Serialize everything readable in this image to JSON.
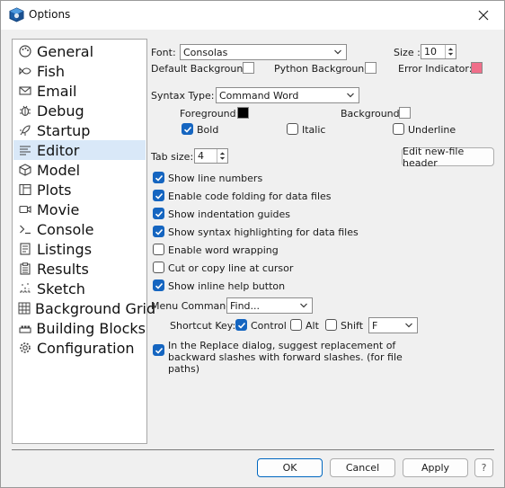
{
  "window": {
    "title": "Options"
  },
  "sidebar": {
    "items": [
      {
        "label": "General",
        "icon": "palette-icon"
      },
      {
        "label": "Fish",
        "icon": "fish-icon"
      },
      {
        "label": "Email",
        "icon": "envelope-icon"
      },
      {
        "label": "Debug",
        "icon": "bug-icon"
      },
      {
        "label": "Startup",
        "icon": "rocket-icon"
      },
      {
        "label": "Editor",
        "icon": "text-lines-icon",
        "selected": true
      },
      {
        "label": "Model",
        "icon": "cube-icon"
      },
      {
        "label": "Plots",
        "icon": "plot-window-icon"
      },
      {
        "label": "Movie",
        "icon": "camera-icon"
      },
      {
        "label": "Console",
        "icon": "terminal-prompt-icon"
      },
      {
        "label": "Listings",
        "icon": "list-icon"
      },
      {
        "label": "Results",
        "icon": "clipboard-icon"
      },
      {
        "label": "Sketch",
        "icon": "sketch-icon"
      },
      {
        "label": "Background Grid",
        "icon": "grid-icon"
      },
      {
        "label": "Building Blocks",
        "icon": "blocks-icon"
      },
      {
        "label": "Configuration",
        "icon": "gear-icon"
      }
    ]
  },
  "editor": {
    "font_label": "Font:",
    "font_value": "Consolas",
    "size_label": "Size :",
    "size_value": "10",
    "default_bg_label": "Default Background:",
    "python_bg_label": "Python Background:",
    "error_indicator_label": "Error Indicator:",
    "error_indicator_color": "#f06f8a",
    "syntax_type_label": "Syntax Type:",
    "syntax_type_value": "Command Word",
    "foreground_label": "Foreground:",
    "foreground_color": "#000000",
    "background_label": "Background:",
    "bold_label": "Bold",
    "italic_label": "Italic",
    "underline_label": "Underline",
    "tab_size_label": "Tab size:",
    "tab_size_value": "4",
    "edit_header_button": "Edit new-file header",
    "options": [
      {
        "label": "Show line numbers",
        "checked": true
      },
      {
        "label": "Enable code folding for data files",
        "checked": true
      },
      {
        "label": "Show indentation guides",
        "checked": true
      },
      {
        "label": "Show syntax highlighting for data files",
        "checked": true
      },
      {
        "label": "Enable word wrapping",
        "checked": false
      },
      {
        "label": "Cut or copy line at cursor",
        "checked": false
      },
      {
        "label": "Show inline help button",
        "checked": true
      }
    ],
    "menu_command_label": "Menu Command:",
    "menu_command_value": "Find...",
    "shortcut_key_label": "Shortcut Key:",
    "control_label": "Control",
    "alt_label": "Alt",
    "shift_label": "Shift",
    "shortcut_key_value": "F",
    "replace_note": "In the Replace dialog, suggest replacement of backward slashes with forward slashes. (for file paths)"
  },
  "footer": {
    "ok_label": "OK",
    "cancel_label": "Cancel",
    "apply_label": "Apply",
    "help_label": "?"
  },
  "colors": {
    "accent": "#1565c0",
    "selection": "#d9e8f8"
  }
}
